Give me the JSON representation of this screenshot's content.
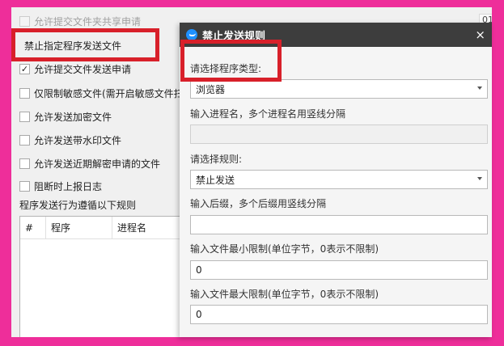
{
  "options": [
    {
      "label": "允许提交文件夹共享申请",
      "checked": false,
      "disabled": true
    },
    {
      "label": "禁止指定程序发送文件",
      "checked": false,
      "disabled": false
    },
    {
      "label": "允许提交文件发送申请",
      "checked": true,
      "disabled": false
    },
    {
      "label": "仅限制敏感文件(需开启敏感文件扫",
      "checked": false,
      "disabled": false
    },
    {
      "label": "允许发送加密文件",
      "checked": false,
      "disabled": false
    },
    {
      "label": "允许发送带水印文件",
      "checked": false,
      "disabled": false
    },
    {
      "label": "允许发送近期解密申请的文件",
      "checked": false,
      "disabled": false
    },
    {
      "label": "阻断时上报日志",
      "checked": false,
      "disabled": false
    }
  ],
  "rules_section_label": "程序发送行为遵循以下规则",
  "table": {
    "columns": [
      "#",
      "程序",
      "进程名"
    ]
  },
  "top_right_text": "01:",
  "dialog": {
    "title": "禁止发送规则",
    "close_symbol": "×",
    "program_type_label": "请选择程序类型:",
    "program_type_value": "浏览器",
    "process_name_label": "输入进程名，多个进程名用竖线分隔",
    "process_name_value": "",
    "rule_label": "请选择规则:",
    "rule_value": "禁止发送",
    "suffix_label": "输入后缀，多个后缀用竖线分隔",
    "suffix_value": "",
    "min_label": "输入文件最小限制(单位字节，0表示不限制)",
    "min_value": "0",
    "max_label": "输入文件最大限制(单位字节，0表示不限制)",
    "max_value": "0"
  },
  "colors": {
    "frame": "#ee2e9a",
    "highlight": "#d8202a",
    "dialog_titlebar": "#3d3d3d"
  }
}
